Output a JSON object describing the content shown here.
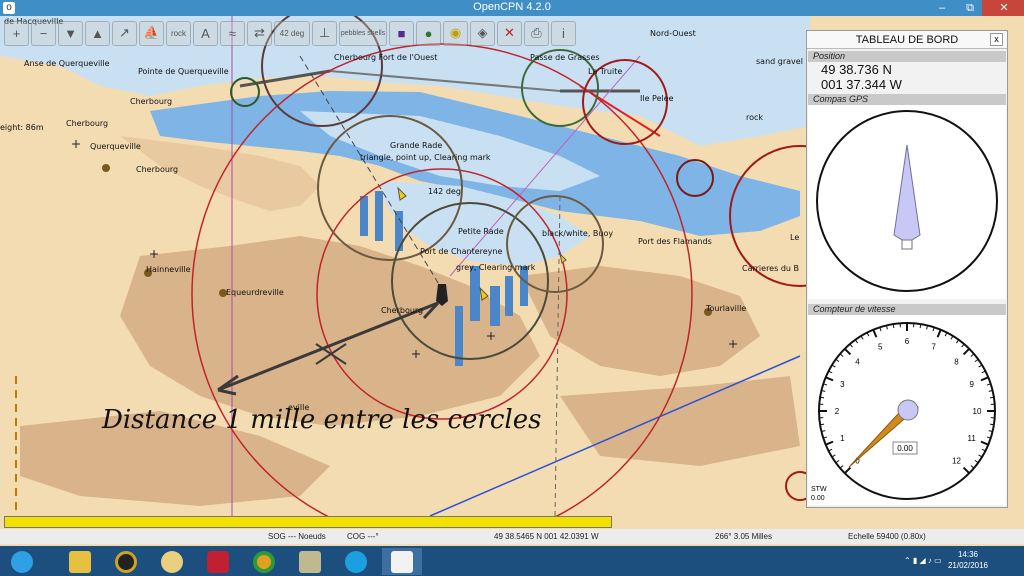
{
  "window": {
    "title": "OpenCPN 4.2.0",
    "minimize": "–",
    "restore": "⧉",
    "close": "✕"
  },
  "toolbar": {
    "zoom_in": "+",
    "zoom_out": "−",
    "rock_label": "rock",
    "deg_label": "42 deg",
    "pebbles": "pebbles shells"
  },
  "chart": {
    "labels": {
      "harqueville": "de Hacqueville",
      "anse": "Anse de Querqueville",
      "pointe": "Pointe de Querqueville",
      "cherbourg1": "Cherbourg",
      "cherbourg2": "Cherbourg",
      "cherbourg3": "Cherbourg",
      "cherbourg_port": "Cherbourg",
      "height": "eight: 86m",
      "querqueville": "Querqueville",
      "fort": "Cherbourg Fort de l'Ouest",
      "passe": "Passe de Grasses",
      "la_truite": "La Truite",
      "nord_ouest": "Nord-Ouest",
      "ile_pelee": "Ile Pelee",
      "sand_gravel": "sand gravel",
      "rock": "rock",
      "grande_rade": "Grande Rade",
      "clearing1": "triangle, point up, Clearing mark",
      "deg142": "142 deg",
      "petite_rade": "Petite Rade",
      "chantereyne": "Port de Chantereyne",
      "clearing2": "grey, Clearing mark",
      "blackwhite": "black/white, Buoy",
      "flamands": "Port des Flamands",
      "carrieres": "Carrieres du B",
      "hainneville": "Hainneville",
      "equeurdreville": "Equeurdreville",
      "tourlaville": "Tourlaville",
      "le": "Le",
      "eville": "eville",
      "distance": "Distance 1 mille entre les cercles"
    }
  },
  "dashboard": {
    "title": "TABLEAU DE BORD",
    "close": "x",
    "position_label": "Position",
    "lat": "49 38.736 N",
    "lon": "001 37.344 W",
    "compass_label": "Compas GPS",
    "speed_label": "Compteur de vitesse",
    "speed_ticks": [
      "0",
      "1",
      "2",
      "3",
      "4",
      "5",
      "6",
      "7",
      "8",
      "9",
      "10",
      "11",
      "12"
    ],
    "speed_value": "0.00",
    "stw_label": "STW",
    "stw_value": "0.00"
  },
  "status": {
    "sog": "SOG --- Noeuds",
    "cog": "COG ---°",
    "cursor": "49 38.5465 N   001 42.0391 W",
    "bearing": "266°  3.05 Milles",
    "scale": "Echelle 59400 (0.80x)"
  },
  "taskbar": {
    "time": "14:36",
    "date": "21/02/2016"
  }
}
